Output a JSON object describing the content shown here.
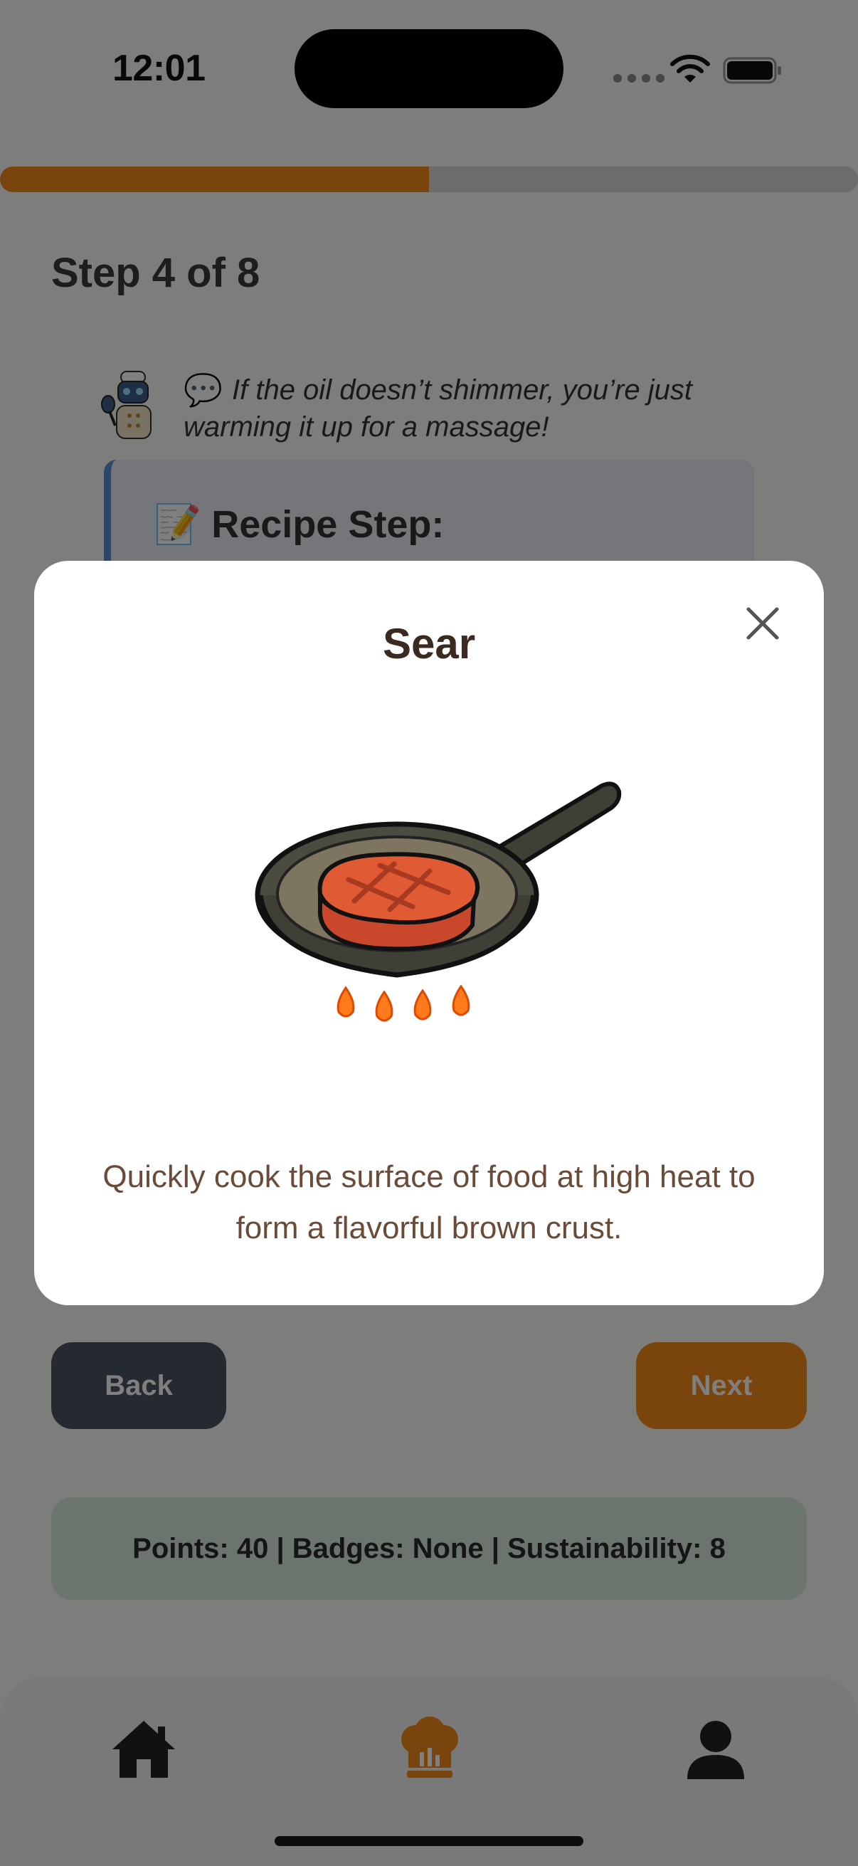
{
  "status_bar": {
    "time": "12:01"
  },
  "progress": {
    "fraction": 0.5
  },
  "step": {
    "title": "Step 4 of 8"
  },
  "hint": {
    "text": "If the oil doesn’t shimmer, you’re just warming it up for a massage!"
  },
  "recipe_card": {
    "title": "Recipe Step:"
  },
  "actions": {
    "back_label": "Back",
    "next_label": "Next"
  },
  "stats": {
    "text": "Points: 40 | Badges: None | Sustainability: 8"
  },
  "modal": {
    "title": "Sear",
    "description": "Quickly cook the surface of food at high heat to form a flavorful brown crust."
  },
  "tabs": [
    {
      "icon": "home-icon"
    },
    {
      "icon": "chef-hat-icon",
      "active": true
    },
    {
      "icon": "profile-icon"
    }
  ],
  "colors": {
    "accent": "#f58a18",
    "back_button": "#4b5563",
    "stats_bg": "#d6eadd",
    "card_border": "#5b8fd6"
  }
}
